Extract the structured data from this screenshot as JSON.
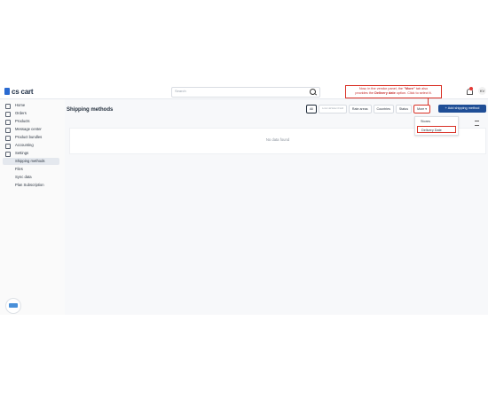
{
  "app": {
    "logo_text": "cs cart"
  },
  "search": {
    "placeholder": "Search"
  },
  "user": {
    "initials": "KV"
  },
  "sidebar": {
    "items": [
      {
        "label": "Home",
        "icon": "home-icon"
      },
      {
        "label": "Orders",
        "icon": "orders-icon"
      },
      {
        "label": "Products",
        "icon": "products-icon"
      },
      {
        "label": "Message center",
        "icon": "message-icon"
      },
      {
        "label": "Product bundles",
        "icon": "bundles-icon"
      },
      {
        "label": "Accounting",
        "icon": "accounting-icon"
      },
      {
        "label": "Settings",
        "icon": "settings-icon"
      }
    ],
    "sub_items": [
      {
        "label": "Shipping methods",
        "active": true
      },
      {
        "label": "Files",
        "active": false
      },
      {
        "label": "Sync data",
        "active": false
      },
      {
        "label": "Plan Subscription",
        "active": false
      }
    ]
  },
  "main": {
    "title": "Shipping methods",
    "filters": {
      "all": "All",
      "faint": "Lorem ■ Select Field",
      "rate_areas": "Rate areas",
      "countries": "Countries",
      "status": "Status",
      "more": "More ▾"
    },
    "add_button": "+ Add shipping method",
    "no_data": "No data found"
  },
  "dropdown": {
    "items": [
      "Stores",
      "Delivery Date"
    ]
  },
  "callout": {
    "line1_pre": "Now, in the vendor panel, the ",
    "line1_bold": "\"More\"",
    "line1_post": " tab also",
    "line2_pre": "provides the ",
    "line2_bold": "Delivery date",
    "line2_post": " option. Click to select it."
  },
  "colors": {
    "accent": "#1f4e96",
    "highlight": "#d93025"
  }
}
